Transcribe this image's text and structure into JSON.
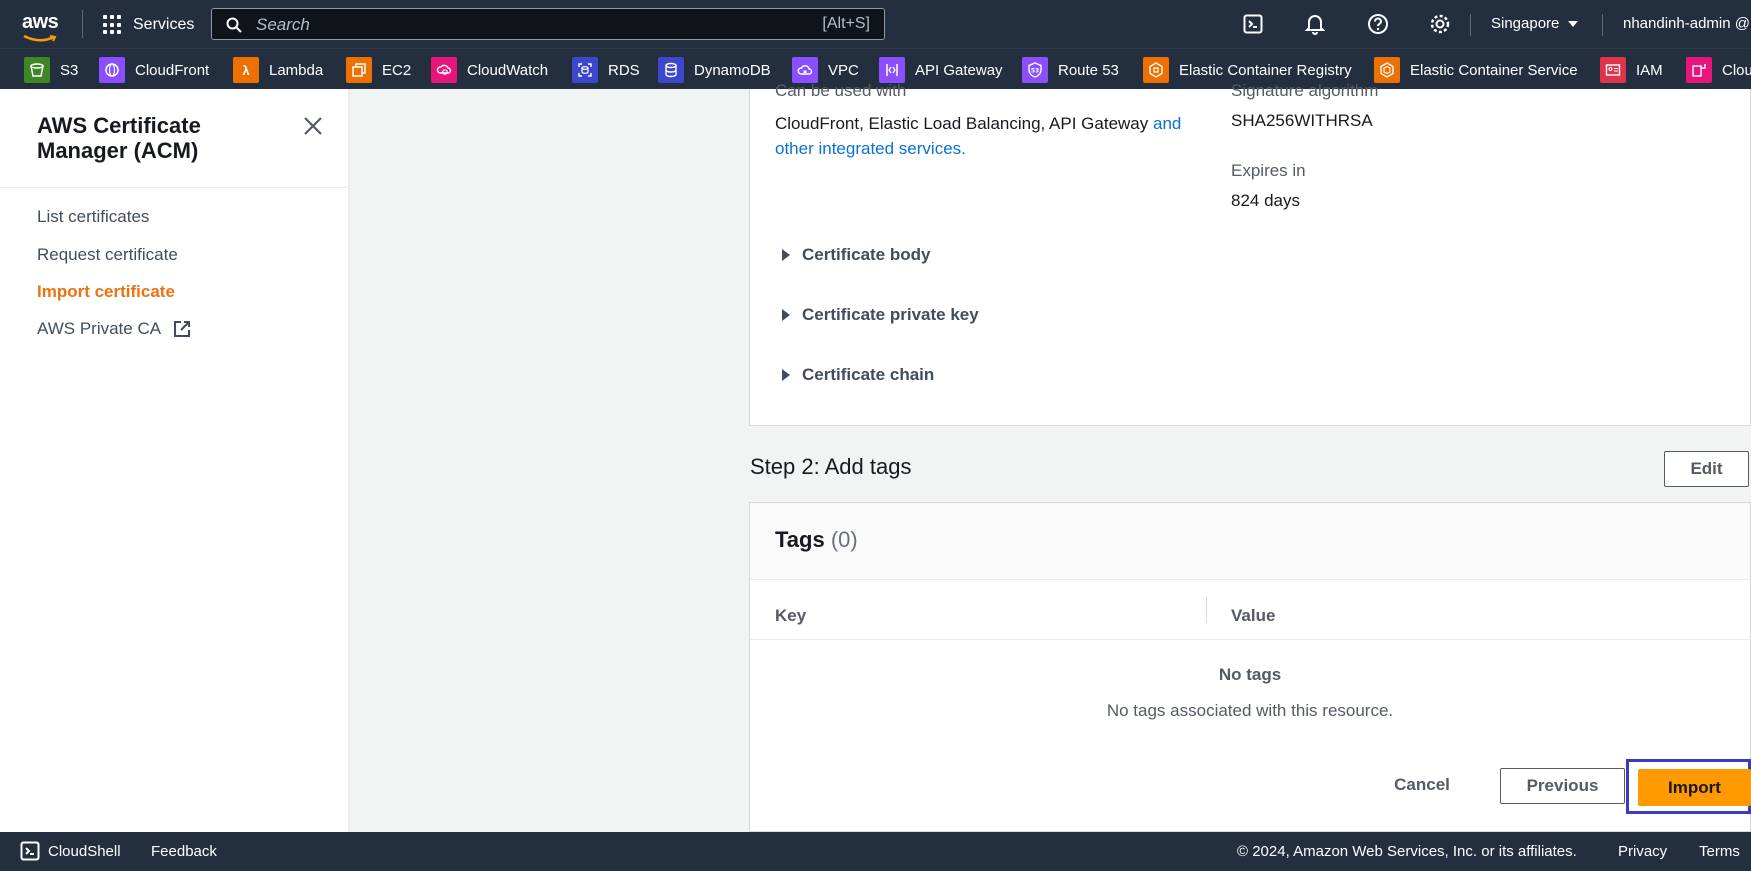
{
  "topnav": {
    "logo": "aws",
    "services_label": "Services",
    "search_placeholder": "Search",
    "search_shortcut": "[Alt+S]",
    "region": "Singapore",
    "account": "nhandinh-admin @",
    "icons": [
      "cloudshell-icon",
      "bell-icon",
      "help-icon",
      "gear-icon"
    ]
  },
  "favorites": [
    {
      "label": "S3",
      "color": "#3f8624"
    },
    {
      "label": "CloudFront",
      "color": "#8c4fff"
    },
    {
      "label": "Lambda",
      "color": "#ed7100"
    },
    {
      "label": "EC2",
      "color": "#ed7100"
    },
    {
      "label": "CloudWatch",
      "color": "#e7157b"
    },
    {
      "label": "RDS",
      "color": "#3b48cc"
    },
    {
      "label": "DynamoDB",
      "color": "#3b48cc"
    },
    {
      "label": "VPC",
      "color": "#8c4fff"
    },
    {
      "label": "API Gateway",
      "color": "#8c4fff"
    },
    {
      "label": "Route 53",
      "color": "#8c4fff"
    },
    {
      "label": "Elastic Container Registry",
      "color": "#ed7100"
    },
    {
      "label": "Elastic Container Service",
      "color": "#ed7100"
    },
    {
      "label": "IAM",
      "color": "#dd344c"
    },
    {
      "label": "Clou",
      "color": "#e7157b"
    }
  ],
  "sidenav": {
    "title": "AWS Certificate Manager (ACM)",
    "items": [
      {
        "label": "List certificates"
      },
      {
        "label": "Request certificate"
      },
      {
        "label": "Import certificate"
      },
      {
        "label": "AWS Private CA"
      }
    ]
  },
  "details": {
    "can_be_used_label": "Can be used with",
    "can_be_used_value": "CloudFront, Elastic Load Balancing, API Gateway",
    "can_be_used_link_1": "and",
    "can_be_used_link_2": "other integrated services.",
    "signature_label": "Signature algorithm",
    "signature_value": "SHA256WITHRSA",
    "expires_label": "Expires in",
    "expires_value": "824 days",
    "expanders": [
      "Certificate body",
      "Certificate private key",
      "Certificate chain"
    ]
  },
  "step2": {
    "title": "Step 2: Add tags",
    "edit_label": "Edit",
    "tags_title": "Tags",
    "tags_count": "(0)",
    "col_key": "Key",
    "col_value": "Value",
    "empty_title": "No tags",
    "empty_sub": "No tags associated with this resource."
  },
  "actions": {
    "cancel": "Cancel",
    "previous": "Previous",
    "import": "Import"
  },
  "footer": {
    "cloudshell": "CloudShell",
    "feedback": "Feedback",
    "copyright": "© 2024, Amazon Web Services, Inc. or its affiliates.",
    "privacy": "Privacy",
    "terms": "Terms"
  }
}
